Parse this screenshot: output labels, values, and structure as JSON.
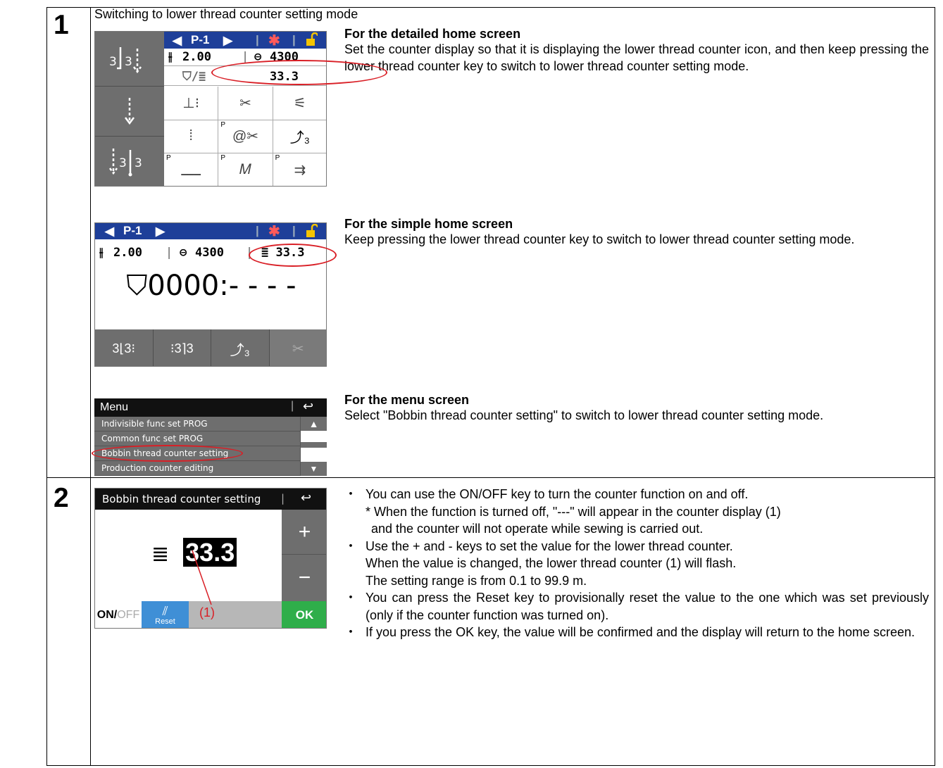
{
  "steps": [
    {
      "number": "1",
      "title": "Switching to lower thread counter setting mode"
    },
    {
      "number": "2"
    }
  ],
  "sections": {
    "detailed": {
      "title": "For the detailed home screen",
      "body": "Set the counter display so that it is displaying the lower thread counter icon, and then keep pressing the lower thread counter key to switch to lower thread counter setting mode."
    },
    "simple": {
      "title": "For the simple home screen",
      "body": "Keep pressing the lower thread counter key to switch to lower thread counter setting mode."
    },
    "menu": {
      "title": "For the menu screen",
      "body": "Select \"Bobbin thread counter setting\" to switch to lower thread counter setting mode."
    }
  },
  "detailed_screen": {
    "pattern": "P-1",
    "stitch_length": "2.00",
    "speed": "4300",
    "counter_value": "33.3",
    "left_buttons": [
      "3 3",
      "",
      "3 3"
    ]
  },
  "simple_screen": {
    "pattern": "P-1",
    "stitch_length": "2.00",
    "speed": "4300",
    "counter_value": "33.3",
    "production_count": "0000:- - - -"
  },
  "menu_screen": {
    "title": "Menu",
    "items": [
      "Indivisible func set PROG",
      "Common func set PROG",
      "Bobbin thread counter setting",
      "Production counter editing"
    ]
  },
  "bobbin_screen": {
    "title": "Bobbin thread counter setting",
    "value": "33.3",
    "plus": "+",
    "minus": "−",
    "on": "ON/",
    "off": "OFF",
    "reset": "Reset",
    "ok": "OK",
    "annotation": "(1)"
  },
  "step2_bullets": [
    {
      "text": "You can use the ON/OFF key to turn the counter function on and off."
    },
    {
      "note": "* When the function is turned off, \"---\" will appear in the counter display (1)"
    },
    {
      "note2": "and the counter will not operate while sewing is carried out."
    },
    {
      "text": "Use the + and - keys to set the value for the lower thread counter."
    },
    {
      "note": "When the value is changed, the lower thread counter (1) will flash."
    },
    {
      "note": "The setting range is from 0.1 to 99.9 m."
    },
    {
      "text": "You can press the Reset key to provisionally reset the value to the one which was set previously (only if the counter function was turned on)."
    },
    {
      "text": "If you press the OK key, the value will be confirmed and the display will return to the home screen."
    }
  ],
  "colors": {
    "accent_red": "#d91f26",
    "header_blue": "#1e3f99",
    "button_gray": "#6e6e6e",
    "reset_blue": "#3f8fd6",
    "ok_green": "#2fae4a"
  }
}
